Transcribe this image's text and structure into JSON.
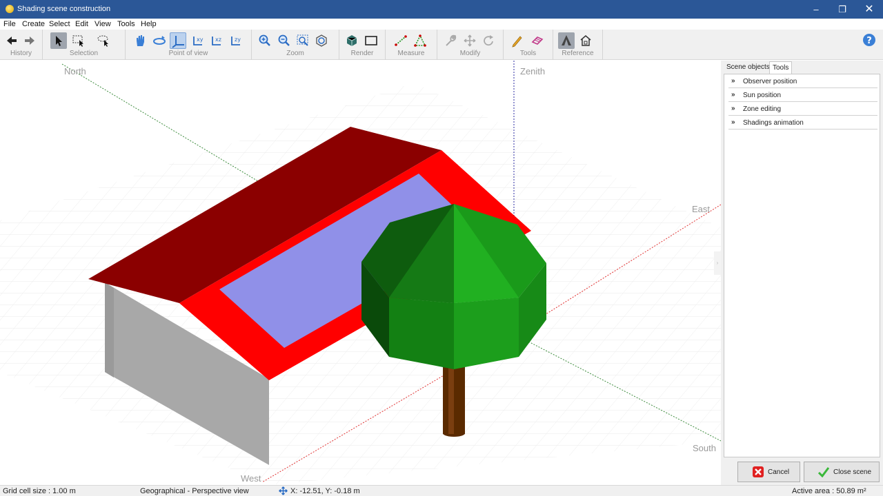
{
  "window": {
    "title": "Shading scene construction",
    "controls": [
      "minimize-icon",
      "restore-icon",
      "close-icon"
    ]
  },
  "menu": [
    "File",
    "Create",
    "Select",
    "Edit",
    "View",
    "Tools",
    "Help"
  ],
  "toolbar": {
    "groups": {
      "history": "History",
      "selection": "Selection",
      "point_of_view": "Point of view",
      "zoom": "Zoom",
      "render": "Render",
      "measure": "Measure",
      "modify": "Modify",
      "tools": "Tools",
      "reference": "Reference"
    },
    "icons": [
      "back-arrow-icon",
      "forward-arrow-icon",
      "pointer-icon",
      "rectangle-select-icon",
      "lasso-select-icon",
      "pan-hand-icon",
      "orbit-icon",
      "axes-icon",
      "xy-view-icon",
      "xz-view-icon",
      "zy-view-icon",
      "zoom-in-icon",
      "zoom-out-icon",
      "zoom-window-icon",
      "zoom-fit-icon",
      "render-solid-icon",
      "render-wireframe-icon",
      "measure-line-icon",
      "measure-angle-icon",
      "wrench-icon",
      "move-icon",
      "rotate-icon",
      "pencil-icon",
      "eraser-icon",
      "tent-reference-icon",
      "house-reference-icon"
    ]
  },
  "viewport": {
    "labels": {
      "north": "North",
      "zenith": "Zenith",
      "east": "East",
      "south": "South",
      "west": "West"
    },
    "colors": {
      "roof_dark": "#8b0000",
      "roof_edge": "#ff0000",
      "panel": "#9090e8",
      "wall": "#a8a8a8",
      "foliage": "#1b8c1b",
      "trunk": "#5a2a00"
    }
  },
  "right_panel": {
    "tabs": [
      "Scene objects",
      "Tools"
    ],
    "active_tab": "Tools",
    "tools_items": [
      "Observer position",
      "Sun position",
      "Zone editing",
      "Shadings animation"
    ],
    "buttons": {
      "cancel": "Cancel",
      "close_scene": "Close scene"
    }
  },
  "statusbar": {
    "grid_cell_size": "Grid cell size :  1.00 m",
    "view_mode": "Geographical - Perspective view",
    "coords": "X: -12.51, Y: -0.18 m",
    "active_area": "Active area :  50.89 m²"
  }
}
